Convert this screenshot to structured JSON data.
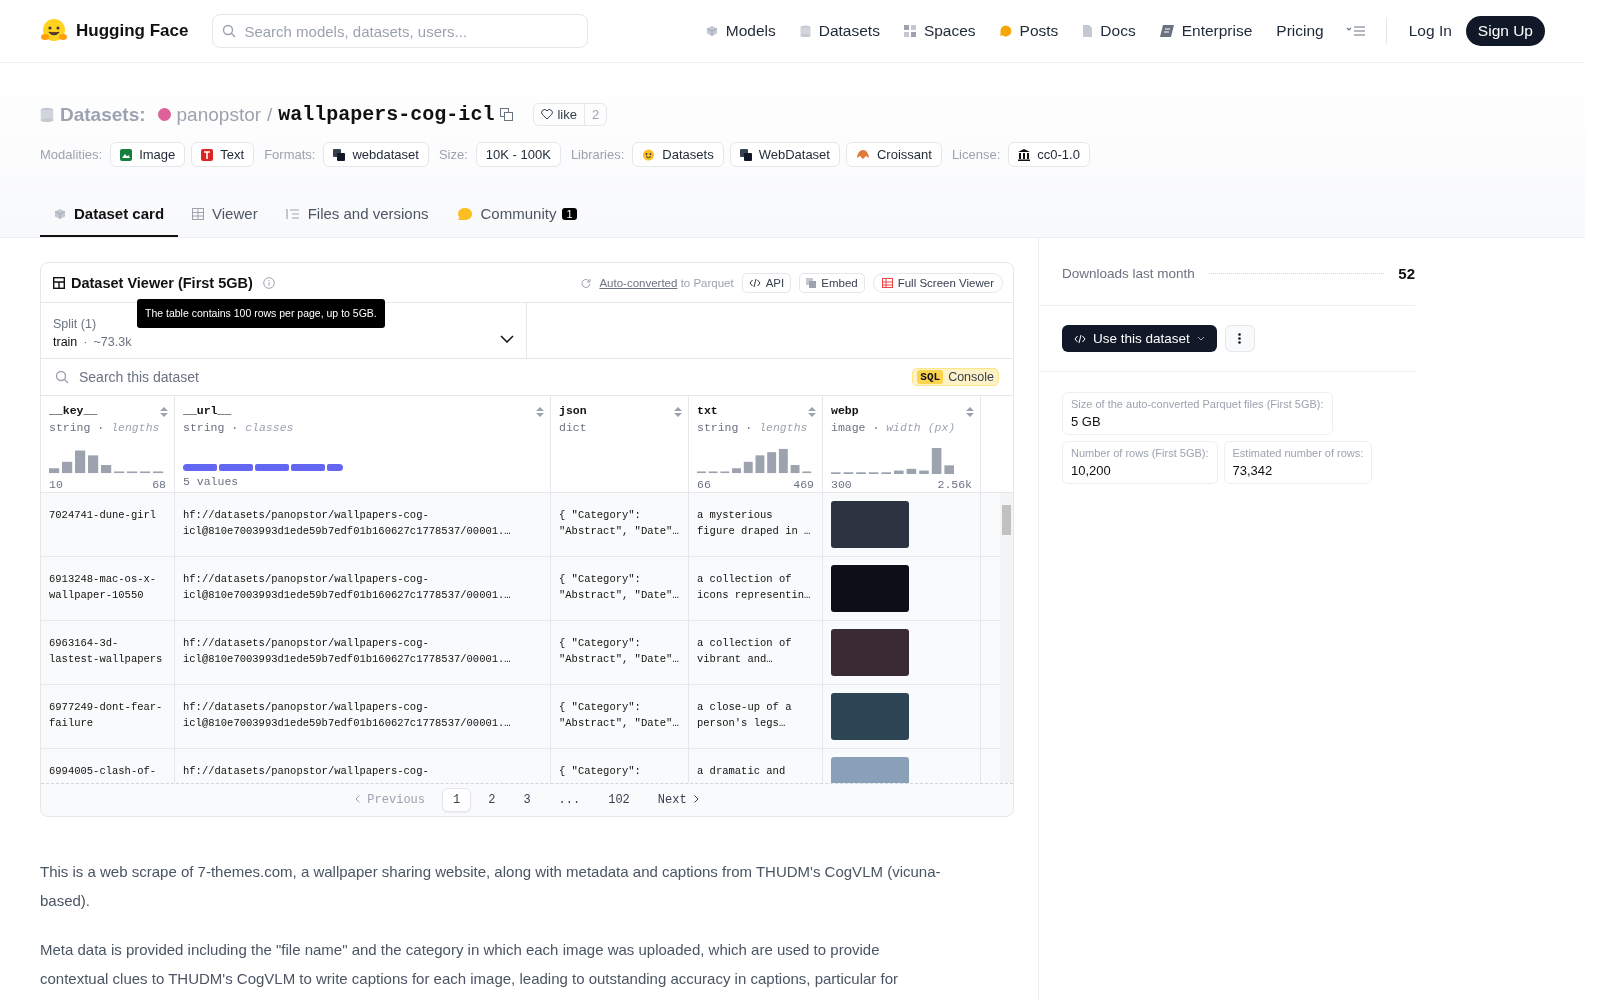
{
  "header": {
    "brand": "Hugging Face",
    "search": {
      "placeholder": "Search models, datasets, users..."
    },
    "nav": [
      {
        "kind": "models",
        "label": "Models"
      },
      {
        "kind": "datasets",
        "label": "Datasets"
      },
      {
        "kind": "spaces",
        "label": "Spaces"
      },
      {
        "kind": "posts",
        "label": "Posts"
      },
      {
        "kind": "docs",
        "label": "Docs"
      },
      {
        "kind": "enterprise",
        "label": "Enterprise"
      },
      {
        "kind": "plain",
        "label": "Pricing"
      }
    ],
    "login": "Log In",
    "signup": "Sign Up"
  },
  "repo": {
    "type_label": "Datasets:",
    "owner": "panopstor",
    "separator": "/",
    "name": "wallpapers-cog-icl",
    "like_label": "like",
    "like_count": "2",
    "metadata": [
      {
        "label": "Modalities:",
        "chips": [
          {
            "kind": "image",
            "text": "Image"
          },
          {
            "kind": "text",
            "text": "Text"
          }
        ]
      },
      {
        "label": "Formats:",
        "chips": [
          {
            "kind": "format",
            "text": "webdataset"
          }
        ]
      },
      {
        "label": "Size:",
        "chips": [
          {
            "kind": "plain",
            "text": "10K - 100K"
          }
        ]
      },
      {
        "label": "Libraries:",
        "chips": [
          {
            "kind": "hf",
            "text": "Datasets"
          },
          {
            "kind": "format",
            "text": "WebDataset"
          },
          {
            "kind": "croissant",
            "text": "Croissant"
          }
        ]
      },
      {
        "label": "License:",
        "chips": [
          {
            "kind": "license",
            "text": "cc0-1.0"
          }
        ]
      }
    ],
    "tabs": [
      {
        "kind": "card",
        "label": "Dataset card",
        "selected": true
      },
      {
        "kind": "viewer",
        "label": "Viewer",
        "selected": false
      },
      {
        "kind": "files",
        "label": "Files and versions",
        "selected": false
      },
      {
        "kind": "community",
        "label": "Community",
        "badge": "1",
        "selected": false
      }
    ]
  },
  "viewer": {
    "title": "Dataset Viewer (First 5GB)",
    "tooltip": "The table contains 100 rows per page, up to 5GB.",
    "converted_link": "Auto-converted",
    "converted_rest": "to Parquet",
    "buttons": [
      {
        "kind": "api",
        "label": "API"
      },
      {
        "kind": "embed",
        "label": "Embed"
      },
      {
        "kind": "fullscreen",
        "label": "Full Screen Viewer"
      }
    ],
    "split": {
      "label": "Split (1)",
      "value": "train",
      "dot": "·",
      "note": "~73.3k"
    },
    "search": {
      "placeholder": "Search this dataset"
    },
    "sql": {
      "badge": "SQL",
      "label": "Console"
    },
    "columns": [
      {
        "name": "__key__",
        "type": "string",
        "dot": "·",
        "stat": "lengths",
        "min": "10",
        "max": "68"
      },
      {
        "name": "__url__",
        "type": "string",
        "dot": "·",
        "stat": "classes",
        "values_note": "5 values"
      },
      {
        "name": "json",
        "type": "dict"
      },
      {
        "name": "txt",
        "type": "string",
        "dot": "·",
        "stat": "lengths",
        "min": "66",
        "max": "469"
      },
      {
        "name": "webp",
        "type": "image",
        "dot": "·",
        "stat": "width (px)",
        "min": "300",
        "max": "2.56k"
      }
    ],
    "rows": [
      {
        "key": "7024741-dune-girl",
        "url": "hf://datasets/panopstor/wallpapers-cog-icl@810e7003993d1ede59b7edf01b160627c1778537/00001.…",
        "json": "{ \"Category\": \"Abstract\", \"Date\"…",
        "txt": "a mysterious figure draped in …"
      },
      {
        "key": "6913248-mac-os-x-wallpaper-10550",
        "url": "hf://datasets/panopstor/wallpapers-cog-icl@810e7003993d1ede59b7edf01b160627c1778537/00001.…",
        "json": "{ \"Category\": \"Abstract\", \"Date\"…",
        "txt": "a collection of icons representin…"
      },
      {
        "key": "6963164-3d-lastest-wallpapers",
        "url": "hf://datasets/panopstor/wallpapers-cog-icl@810e7003993d1ede59b7edf01b160627c1778537/00001.…",
        "json": "{ \"Category\": \"Abstract\", \"Date\"…",
        "txt": "a collection of vibrant and…"
      },
      {
        "key": "6977249-dont-fear-failure",
        "url": "hf://datasets/panopstor/wallpapers-cog-icl@810e7003993d1ede59b7edf01b160627c1778537/00001.…",
        "json": "{ \"Category\": \"Abstract\", \"Date\"…",
        "txt": "a close-up of a person's legs…"
      },
      {
        "key": "6994005-clash-of-",
        "url": "hf://datasets/panopstor/wallpapers-cog-",
        "json": "{ \"Category\":",
        "txt": "a dramatic and"
      }
    ],
    "pagination": {
      "previous": {
        "label": "Previous",
        "disabled": true
      },
      "pages": [
        {
          "label": "1",
          "selected": true
        },
        {
          "label": "2",
          "selected": false
        },
        {
          "label": "3",
          "selected": false
        },
        {
          "label": "...",
          "selected": false
        },
        {
          "label": "102",
          "selected": false
        }
      ],
      "next": {
        "label": "Next",
        "disabled": false
      }
    }
  },
  "description": [
    "This is a web scrape of 7-themes.com, a wallpaper sharing website, along with metadata and captions from THUDM's CogVLM (vicuna-based).",
    "Meta data is provided including the \"file name\" and the category in which each image was uploaded, which are used to provide contextual clues to THUDM's CogVLM to write captions for each image, leading to outstanding accuracy in captions, particular for"
  ],
  "sidebar": {
    "downloads_label": "Downloads last month",
    "downloads": "52",
    "use_button": "Use this dataset",
    "stats": [
      {
        "label": "Size of the auto-converted Parquet files (First 5GB):",
        "value": "5 GB"
      },
      {
        "label": "Number of rows (First 5GB):",
        "value": "10,200"
      },
      {
        "label": "Estimated number of rows:",
        "value": "73,342"
      }
    ]
  }
}
